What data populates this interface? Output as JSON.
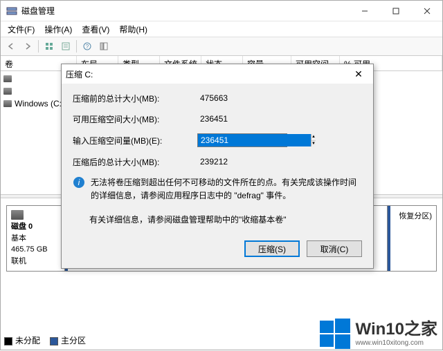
{
  "window": {
    "title": "磁盘管理",
    "menus": [
      "文件(F)",
      "操作(A)",
      "查看(V)",
      "帮助(H)"
    ]
  },
  "table": {
    "headers": [
      "卷",
      "布局",
      "类型",
      "文件系统",
      "状态",
      "容量",
      "可用空间",
      "% 可用"
    ]
  },
  "volumes": [
    {
      "name": ""
    },
    {
      "name": ""
    },
    {
      "name": "Windows (C:)"
    }
  ],
  "disk": {
    "label": "磁盘 0",
    "type": "基本",
    "size": "465.75 GB",
    "status": "联机"
  },
  "partition_label": "恢复分区)",
  "legend": {
    "unallocated": "未分配",
    "primary": "主分区"
  },
  "dialog": {
    "title": "压缩 C:",
    "fields": {
      "total_before_label": "压缩前的总计大小(MB):",
      "total_before_value": "475663",
      "shrink_avail_label": "可用压缩空间大小(MB):",
      "shrink_avail_value": "236451",
      "shrink_amount_label": "输入压缩空间量(MB)(E):",
      "shrink_amount_value": "236451",
      "total_after_label": "压缩后的总计大小(MB):",
      "total_after_value": "239212"
    },
    "info_text": "无法将卷压缩到超出任何不可移动的文件所在的点。有关完成该操作时间的详细信息，请参阅应用程序日志中的 \"defrag\" 事件。",
    "help_text": "有关详细信息，请参阅磁盘管理帮助中的\"收缩基本卷\"",
    "buttons": {
      "shrink": "压缩(S)",
      "cancel": "取消(C)"
    }
  },
  "watermark": {
    "text": "Win10之家",
    "url": "www.win10xitong.com"
  }
}
